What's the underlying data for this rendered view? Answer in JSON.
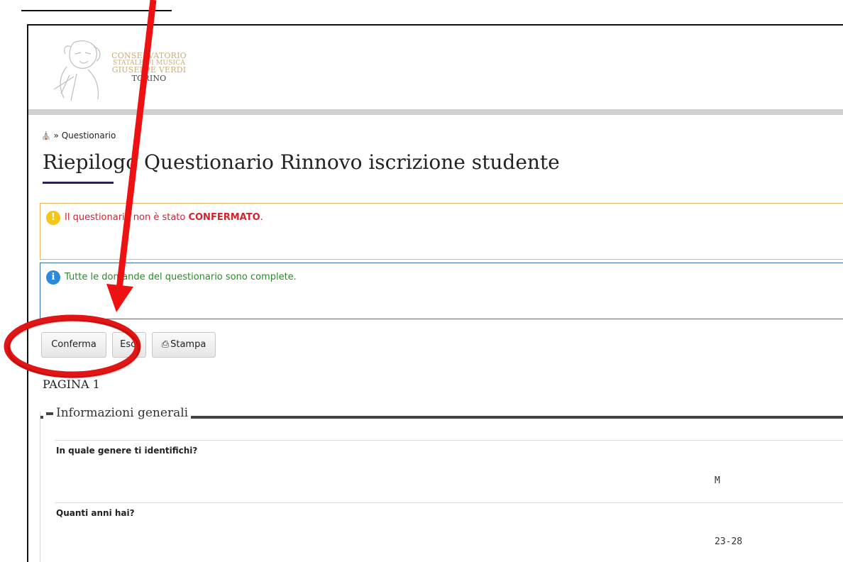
{
  "logo": {
    "line1": "CONSERVATORIO",
    "line2": "STATALE DI MUSICA",
    "line3": "GIUSEPPE VERDI",
    "city": "TORINO"
  },
  "breadcrumb": {
    "home_icon": "home-icon",
    "separator": "»",
    "current": "Questionario"
  },
  "page_title": "Riepilogo Questionario Rinnovo iscrizione studente",
  "alerts": {
    "warning": {
      "icon": "exclamation-icon",
      "text_prefix": "Il questionario non è stato ",
      "text_bold": "CONFERMATO",
      "text_suffix": "."
    },
    "info": {
      "icon": "info-icon",
      "text": "Tutte le domande del questionario sono complete."
    }
  },
  "buttons": {
    "confirm": "Conferma",
    "exit": "Esci",
    "print": "Stampa"
  },
  "page_label": "PAGINA 1",
  "section": {
    "title": "Informazioni generali",
    "questions": [
      {
        "label": "In quale genere ti identifichi?",
        "answer": "M"
      },
      {
        "label": "Quanti anni hai?",
        "answer": "23-28"
      }
    ]
  },
  "colors": {
    "annotation": "#ee1111",
    "warning_border": "#f0b35a",
    "info_border": "#3a6fa8",
    "warning_text": "#d6212b",
    "info_text": "#2a8a2a"
  }
}
